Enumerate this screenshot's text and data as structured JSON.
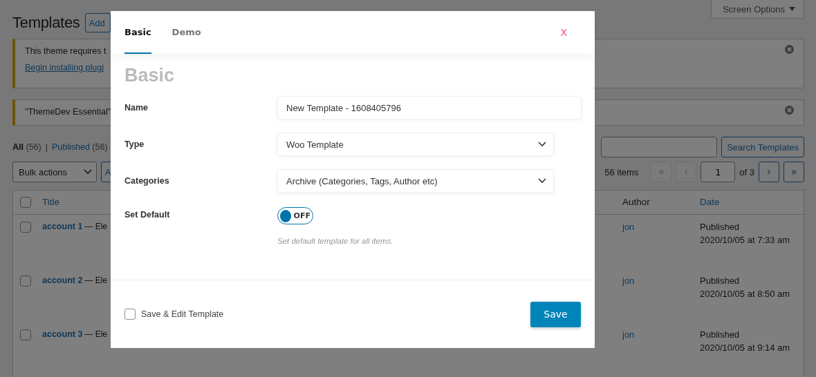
{
  "page": {
    "title": "Templates",
    "add_button": "Add",
    "screen_options": "Screen Options",
    "notices": [
      {
        "text": "This theme requires t",
        "link": "Begin installing plugi"
      },
      {
        "text": "\"ThemeDev Essential\""
      }
    ],
    "separator": "|",
    "filters": [
      {
        "label": "All",
        "count": "(56)",
        "selected": true
      },
      {
        "label": "Published",
        "count": "(56)",
        "selected": false
      }
    ],
    "bulk_actions": "Bulk actions",
    "apply_button": "A",
    "search_button": "Search Templates",
    "pagination": {
      "items": "56 items",
      "buttons": [
        {
          "label": "«",
          "disabled": true
        },
        {
          "label": "‹",
          "disabled": true
        }
      ],
      "page": "1",
      "of": "of 3",
      "next_buttons": [
        {
          "label": "›",
          "disabled": false
        },
        {
          "label": "»",
          "disabled": false
        }
      ]
    },
    "select_all_checked": false,
    "columns": {
      "title": "Title",
      "author": "Author",
      "date": "Date"
    },
    "rows": [
      {
        "title": "account 1",
        "suffix": "— Ele",
        "author": "jon",
        "status": "Published",
        "date": "2020/10/05 at 7:33 am",
        "checked": false
      },
      {
        "title": "account 2",
        "suffix": "— Ele",
        "author": "jon",
        "status": "Published",
        "date": "2020/10/05 at 8:50 am",
        "checked": false
      },
      {
        "title": "account 3",
        "suffix": "— Ele",
        "author": "jon",
        "status": "Published",
        "date": "2020/10/05 at 9:14 am",
        "checked": false
      }
    ]
  },
  "modal": {
    "tabs": [
      {
        "label": "Basic",
        "selected": true
      },
      {
        "label": "Demo",
        "selected": false
      }
    ],
    "close": "X",
    "heading": "Basic",
    "fields": [
      {
        "kind": "text",
        "label": "Name",
        "value": "New Template - 1608405796"
      },
      {
        "kind": "select",
        "label": "Type",
        "value": "Woo Template"
      },
      {
        "kind": "select",
        "label": "Categories",
        "value": "Archive (Categories, Tags, Author etc)"
      },
      {
        "kind": "switch",
        "label": "Set Default",
        "on": false,
        "state_text": "OFF",
        "hint": "Set default template for all items."
      }
    ],
    "footer": {
      "checkbox": {
        "label": "Save & Edit Template",
        "checked": false
      },
      "save": "Save"
    }
  }
}
